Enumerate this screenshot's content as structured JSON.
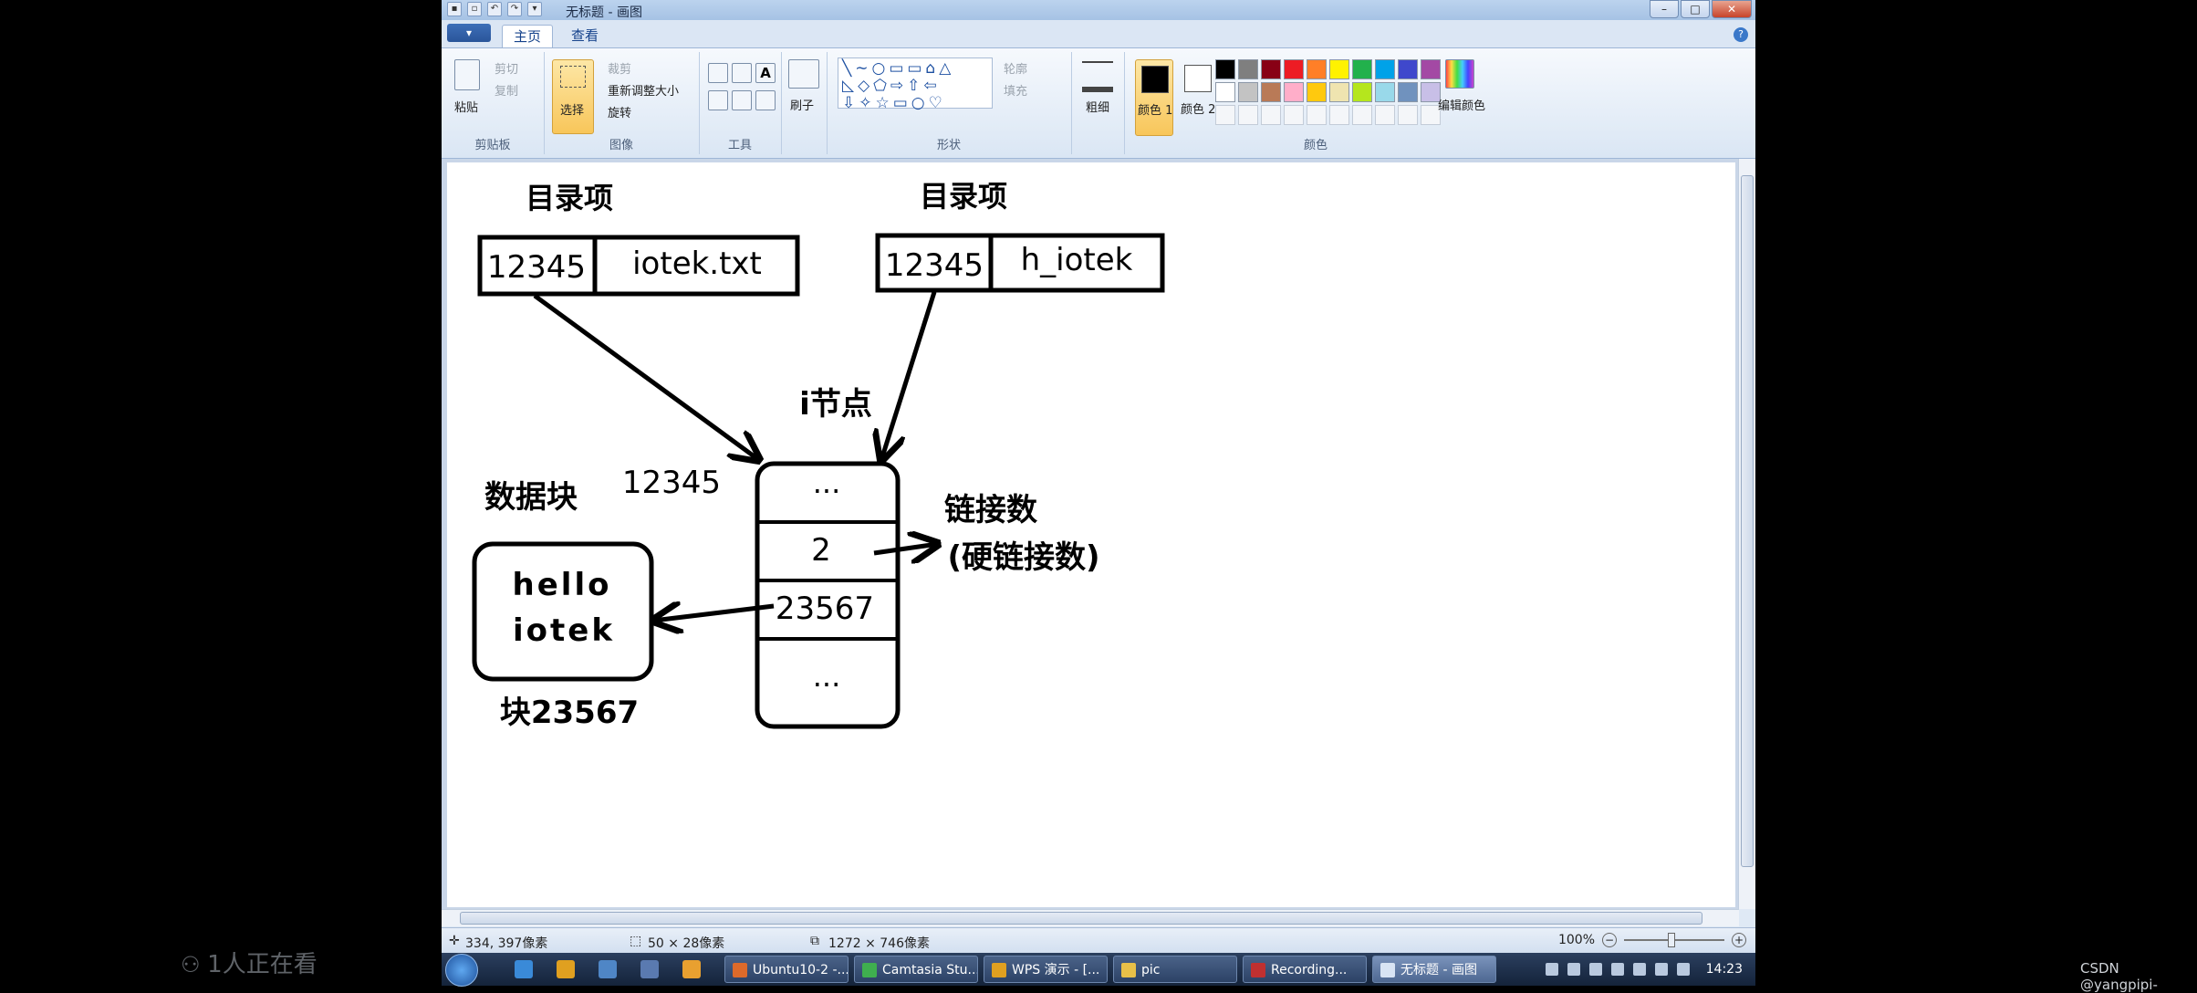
{
  "window": {
    "title": "无标题 - 画图",
    "controls": {
      "minimize": "–",
      "maximize": "□",
      "close": "✕"
    }
  },
  "tabs": {
    "app_menu": "▾",
    "home": "主页",
    "view": "查看",
    "help": "?"
  },
  "ribbon": {
    "clipboard": {
      "group": "剪贴板",
      "paste": "粘贴",
      "cut": "剪切",
      "copy": "复制"
    },
    "image": {
      "group": "图像",
      "select": "选择",
      "crop": "裁剪",
      "resize": "重新调整大小",
      "rotate": "旋转"
    },
    "tools": {
      "group": "工具"
    },
    "brushes": {
      "label": "刷子"
    },
    "shapes": {
      "group": "形状",
      "outline": "轮廓",
      "fill": "填充"
    },
    "size": {
      "label": "粗细"
    },
    "colors": {
      "group": "颜色",
      "color1": "颜色 1",
      "color2": "颜色 2",
      "edit": "编辑颜色",
      "accent": "#f8c65a",
      "palette_row1": [
        "#000000",
        "#7f7f7f",
        "#880015",
        "#ed1c24",
        "#ff7f27",
        "#fff200",
        "#22b14c",
        "#00a2e8",
        "#3f48cc",
        "#a349a4"
      ],
      "palette_row2": [
        "#ffffff",
        "#c3c3c3",
        "#b97a57",
        "#ffaec9",
        "#ffc90e",
        "#efe4b0",
        "#b5e61d",
        "#99d9ea",
        "#7092be",
        "#c8bfe7"
      ]
    }
  },
  "drawing": {
    "entry_label_1": "目录项",
    "entry_label_2": "目录项",
    "entry1_inode": "12345",
    "entry1_name": "iotek.txt",
    "entry2_inode": "12345",
    "entry2_name": "h_iotek",
    "inode_label": "i节点",
    "inode_number": "12345",
    "inode_rows": [
      "...",
      "2",
      "23567",
      "..."
    ],
    "link_count_label": "链接数",
    "link_count_sub": "(硬链接数)",
    "data_block_label": "数据块",
    "data_line1": "hello",
    "data_line2": "iotek",
    "block_label": "块23567"
  },
  "status": {
    "cursor": "334, 397像素",
    "selection": "50 × 28像素",
    "image_size": "1272 × 746像素",
    "zoom": "100%"
  },
  "taskbar": {
    "items": [
      "Ubuntu10-2 -...",
      "Camtasia Stu...",
      "WPS 演示 - [...",
      "pic",
      "Recording...",
      "无标题 - 画图"
    ],
    "time": "14:23"
  },
  "overlay": {
    "viewers": "1人正在看",
    "watermark": "CSDN @yangpipi-"
  }
}
